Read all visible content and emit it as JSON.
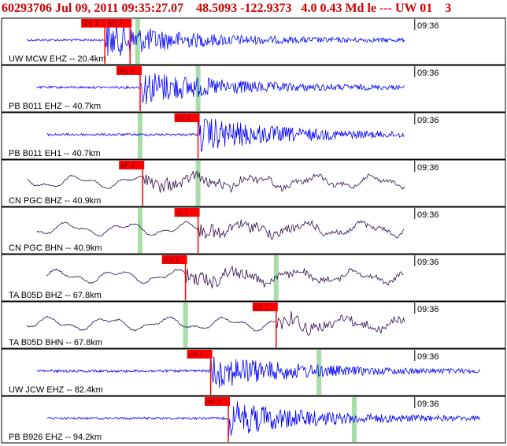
{
  "header": {
    "text": "60293706 Jul 09, 2011 09:35:27.07    48.5093 -122.9373   4.0 0.43 Md le --- UW 01    3"
  },
  "colors": {
    "header": "#d00000",
    "pick_box": "#ff0000",
    "trace_blue": "#0000ff",
    "trace_dark": "#2a0a4a",
    "green_marker": "#a8dca8",
    "border": "#000000"
  },
  "panels": [
    {
      "label": "UW MCW EHZ -- 20.4km",
      "time": "09:36",
      "trace_color": "blue",
      "picks": [
        {
          "label": "iPc 1",
          "x": 0.205
        },
        {
          "label": "eS 2",
          "x": 0.255
        }
      ],
      "green": [
        0.27
      ]
    },
    {
      "label": "PB B011 EHZ -- 40.7km",
      "time": "09:36",
      "trace_color": "blue",
      "picks": [
        {
          "label": "iPd 1",
          "x": 0.275
        }
      ],
      "green": [
        0.39
      ]
    },
    {
      "label": "PB B011 EH1 -- 40.7km",
      "time": "09:36",
      "trace_color": "blue",
      "picks": [
        {
          "label": "eS 2",
          "x": 0.39
        }
      ],
      "green": [
        0.275
      ]
    },
    {
      "label": "CN PGC BHZ -- 40.9km",
      "time": "09:36",
      "trace_color": "dark",
      "picks": [
        {
          "label": "eP 2",
          "x": 0.28
        }
      ],
      "green": [
        0.39
      ]
    },
    {
      "label": "CN PGC BHN -- 40.9km",
      "time": "09:36",
      "trace_color": "dark",
      "picks": [
        {
          "label": "iS 1",
          "x": 0.39
        }
      ],
      "green": [
        0.275
      ]
    },
    {
      "label": "TA B05D BHZ -- 67.8km",
      "time": "09:36",
      "trace_color": "dark",
      "picks": [
        {
          "label": "iPd 1",
          "x": 0.365
        }
      ],
      "green": [
        0.545
      ]
    },
    {
      "label": "TA B05D BHN -- 67.8km",
      "time": "09:36",
      "trace_color": "dark",
      "picks": [
        {
          "label": "eS 2",
          "x": 0.545
        }
      ],
      "green": [
        0.365
      ]
    },
    {
      "label": "UW JCW EHZ -- 82.4km",
      "time": "09:36",
      "trace_color": "blue",
      "picks": [
        {
          "label": "eP 2",
          "x": 0.415
        }
      ],
      "green": [
        0.63
      ]
    },
    {
      "label": "PB B926 EHZ -- 94.2km",
      "time": "09:36",
      "trace_color": "blue",
      "picks": [
        {
          "label": "eP 2",
          "x": 0.45
        }
      ],
      "green": [
        0.7
      ]
    }
  ]
}
